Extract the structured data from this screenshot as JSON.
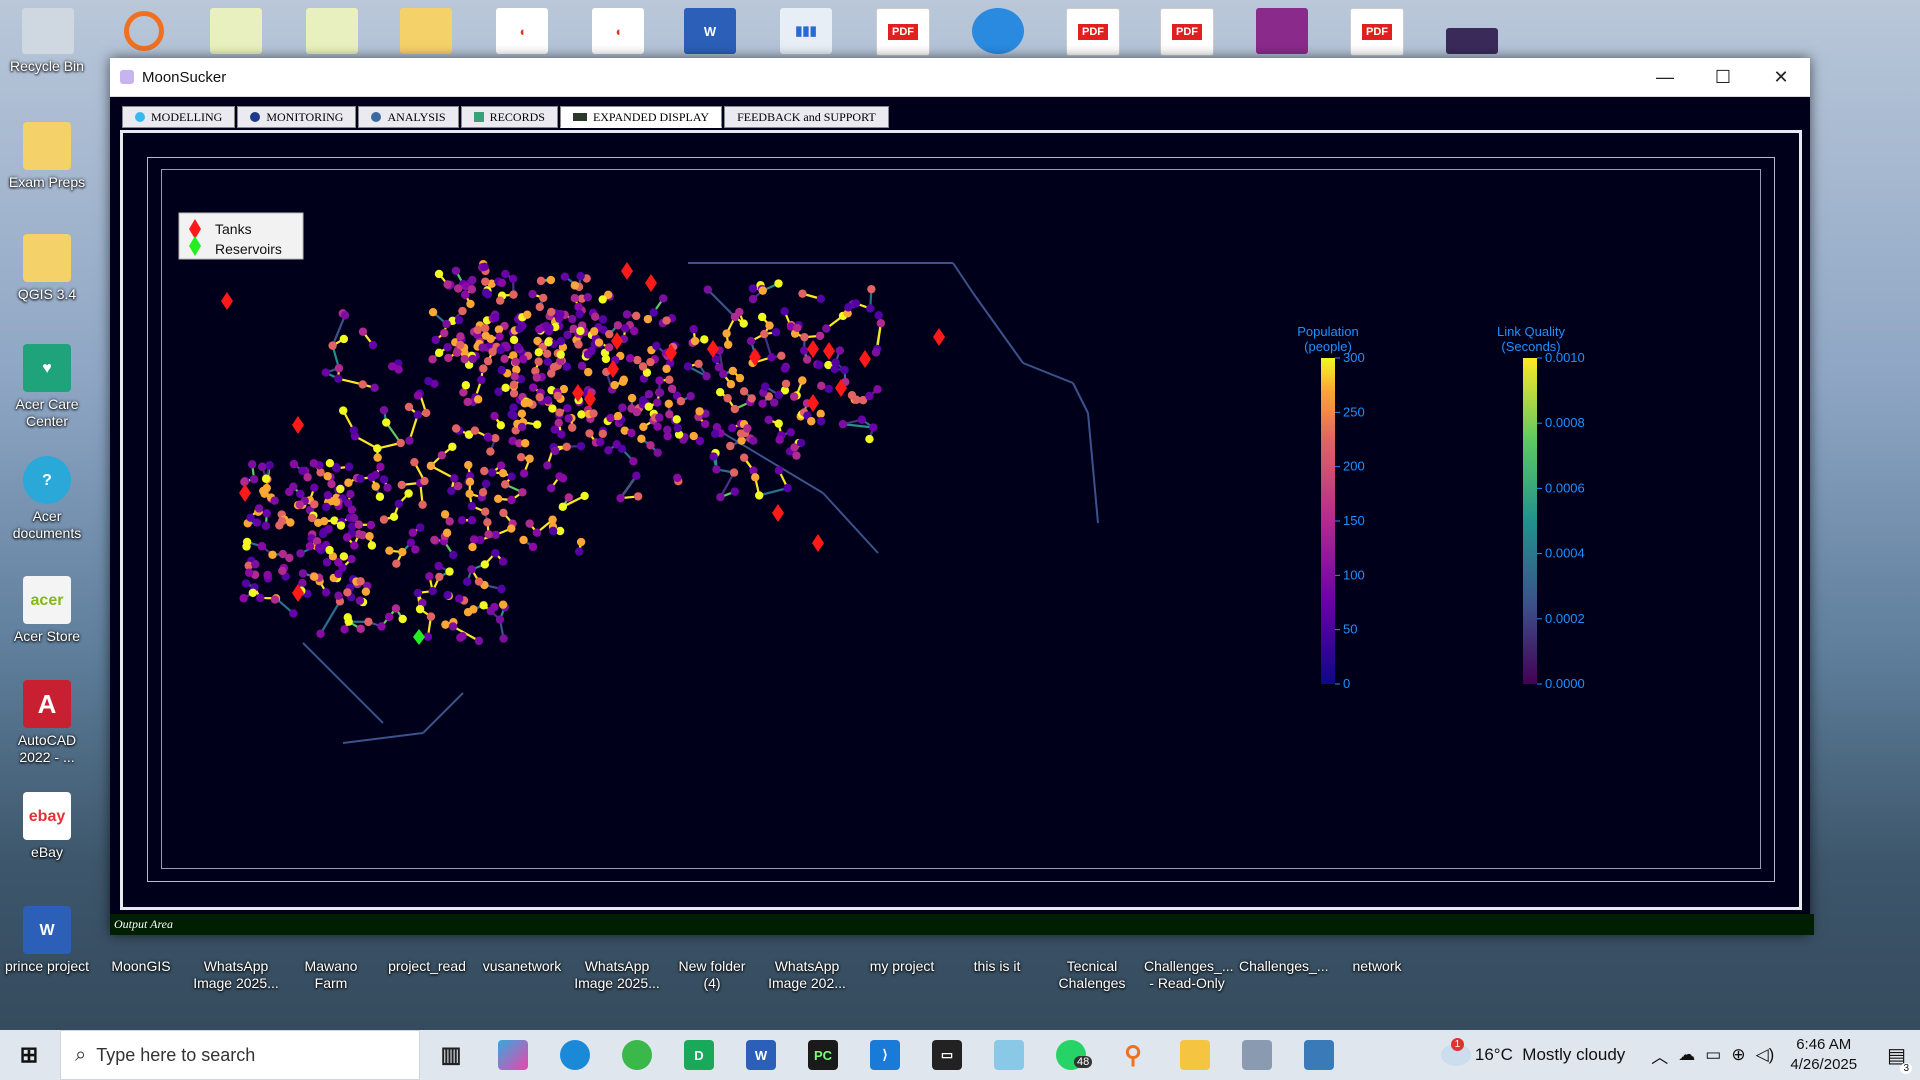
{
  "desktop": {
    "left_icons": [
      {
        "label": "Recycle Bin"
      },
      {
        "label": "Exam Preps"
      },
      {
        "label": "QGIS 3.4"
      },
      {
        "label": "Acer Care Center"
      },
      {
        "label": "Acer documents"
      },
      {
        "label": "Acer Store"
      },
      {
        "label": "AutoCAD 2022 - ..."
      },
      {
        "label": "eBay"
      },
      {
        "label": "prince project"
      }
    ],
    "bottom_icons": [
      {
        "label": "MoonGIS"
      },
      {
        "label": "WhatsApp Image 2025..."
      },
      {
        "label": "Mawano Farm"
      },
      {
        "label": "project_read"
      },
      {
        "label": "vusanetwork"
      },
      {
        "label": "WhatsApp Image 2025..."
      },
      {
        "label": "New folder (4)"
      },
      {
        "label": "WhatsApp Image 202..."
      },
      {
        "label": "my project"
      },
      {
        "label": "this is it"
      },
      {
        "label": "Tecnical Chalenges"
      },
      {
        "label": "Challenges_... - Read-Only"
      },
      {
        "label": "Challenges_..."
      },
      {
        "label": "network"
      }
    ],
    "top_icon_tags": [
      "PDF",
      "PDF",
      "PDF",
      "PDF"
    ]
  },
  "window": {
    "title": "MoonSucker",
    "tabs": [
      {
        "label": "MODELLING",
        "active": false
      },
      {
        "label": "MONITORING",
        "active": false
      },
      {
        "label": "ANALYSIS",
        "active": false
      },
      {
        "label": "RECORDS",
        "active": false
      },
      {
        "label": "EXPANDED DISPLAY",
        "active": true
      },
      {
        "label": "FEEDBACK and SUPPORT",
        "active": false
      }
    ],
    "output_label": "Output Area"
  },
  "plot": {
    "legend": [
      {
        "label": "Tanks",
        "color": "#ff1a1a"
      },
      {
        "label": "Reservoirs",
        "color": "#22ee22"
      }
    ],
    "colorbars": [
      {
        "title_line1": "Population",
        "title_line2": "(people)",
        "ticks": [
          "300",
          "250",
          "200",
          "150",
          "100",
          "50",
          "0"
        ],
        "scheme": "plasma"
      },
      {
        "title_line1": "Link Quality",
        "title_line2": "(Seconds)",
        "ticks": [
          "0.0010",
          "0.0008",
          "0.0006",
          "0.0004",
          "0.0002",
          "0.0000"
        ],
        "scheme": "viridis"
      }
    ],
    "label_color": "#1e90ff"
  },
  "taskbar": {
    "search_placeholder": "Type here to search",
    "whatsapp_badge": "48",
    "weather": "16°C  Mostly cloudy",
    "weather_badge": "1",
    "time": "6:46 AM",
    "date": "4/26/2025",
    "notification_count": "3"
  }
}
